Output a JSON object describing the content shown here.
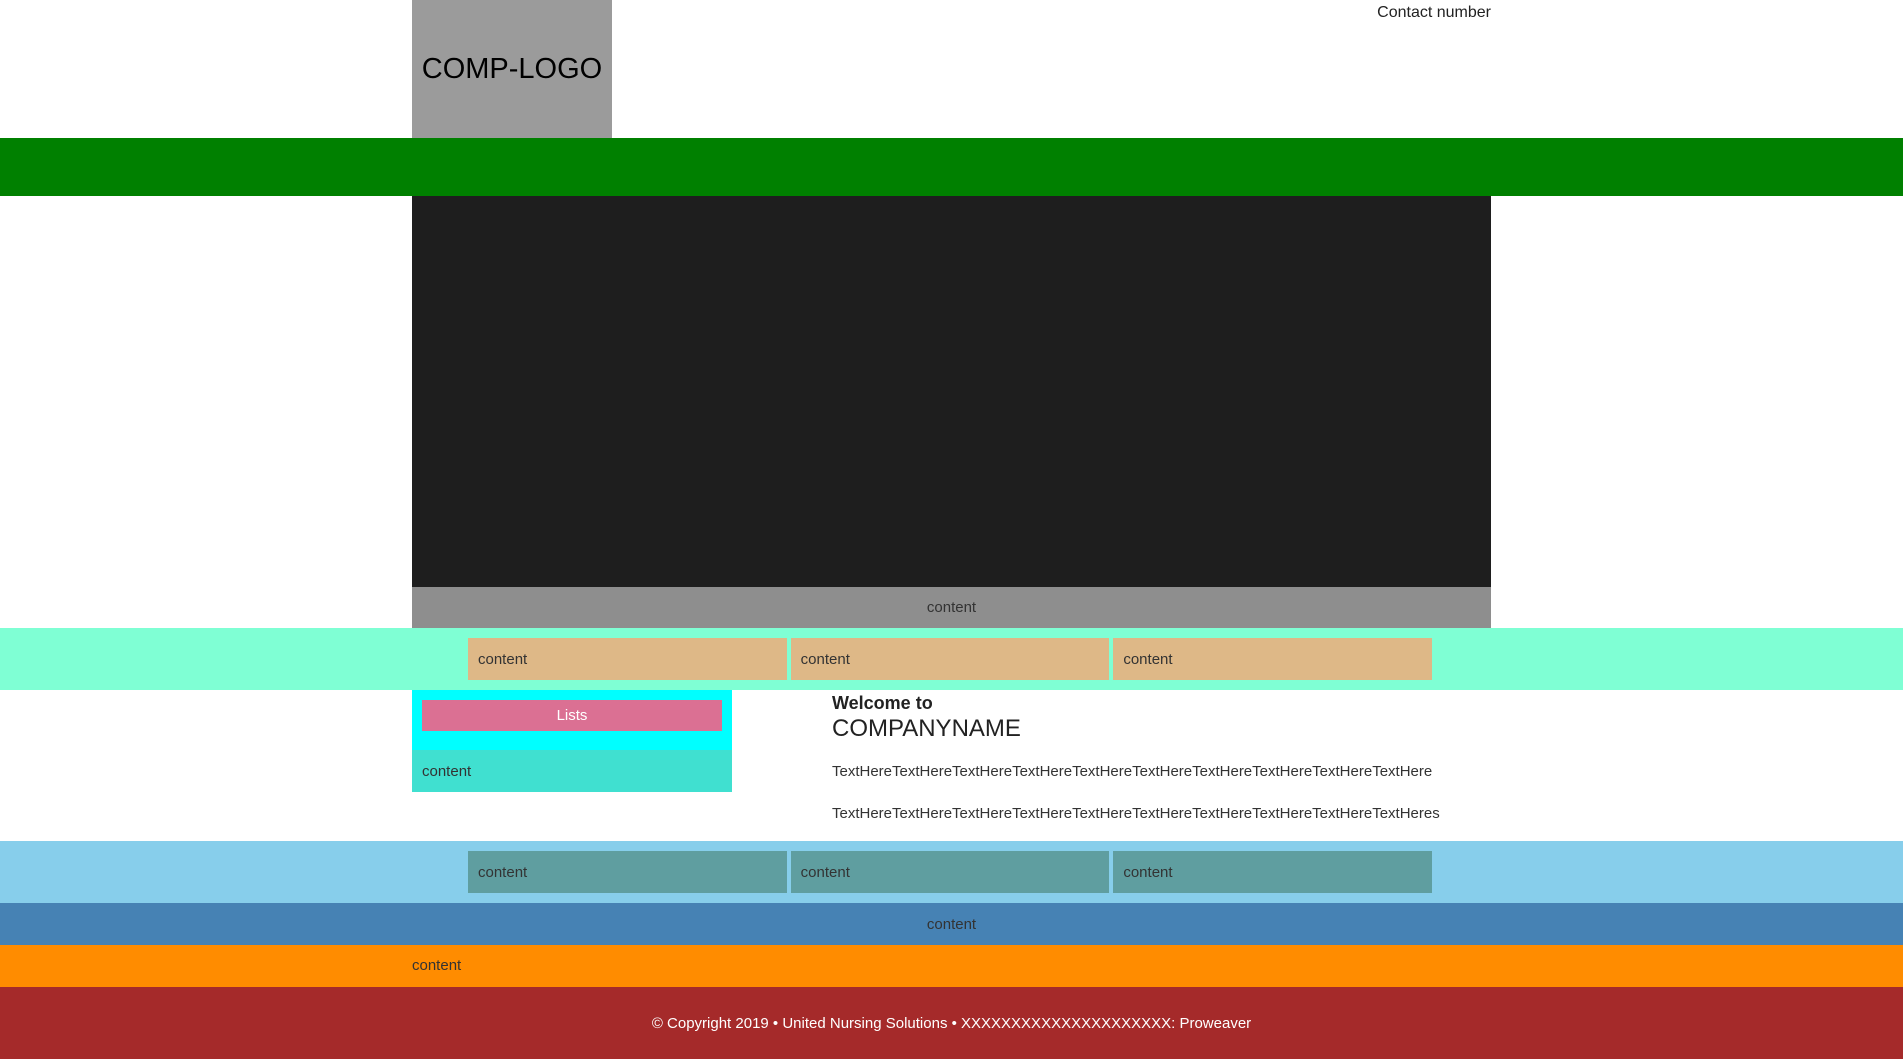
{
  "header": {
    "logo_text": "COMP-LOGO",
    "contact": "Contact number"
  },
  "banner": {
    "caption": "content"
  },
  "strip1": {
    "boxes": [
      "content",
      "content",
      "content"
    ]
  },
  "sidebar": {
    "button_label": "Lists",
    "content": "content"
  },
  "welcome": {
    "heading": "Welcome to",
    "company": "COMPANYNAME",
    "paragraphs": [
      "TextHereTextHereTextHereTextHereTextHereTextHereTextHereTextHereTextHereTextHere",
      "TextHereTextHereTextHereTextHereTextHereTextHereTextHereTextHereTextHereTextHeres"
    ]
  },
  "strip2": {
    "boxes": [
      "content",
      "content",
      "content"
    ]
  },
  "bar_blue": {
    "text": "content"
  },
  "bar_orange": {
    "text": "content"
  },
  "footer": {
    "text": "© Copyright 2019 • United Nursing Solutions • XXXXXXXXXXXXXXXXXXXXX: Proweaver"
  },
  "colors": {
    "nav": "#008000",
    "banner": "#1e1e1e",
    "strip1": "#7fffd4",
    "strip1_box": "#deb887",
    "lists_area": "#00ffff",
    "lists_button": "#db7093",
    "sidebar_content": "#40e0d0",
    "strip2": "#87ceeb",
    "strip2_box": "#5f9ea0",
    "bar_blue": "#4682b4",
    "bar_orange": "#ff8c00",
    "footer": "#a52a2a"
  }
}
